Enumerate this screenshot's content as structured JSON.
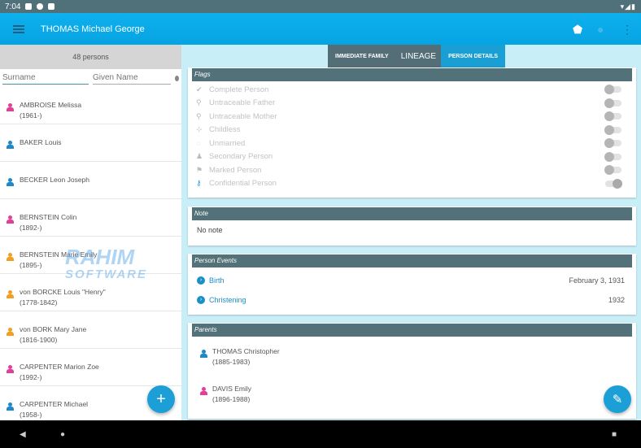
{
  "status": {
    "time": "7:04",
    "right": "▾◢▮"
  },
  "appbar": {
    "title": "THOMAS Michael George"
  },
  "left": {
    "count": "48 persons",
    "surname_placeholder": "Surname",
    "given_placeholder": "Given Name",
    "persons": [
      {
        "name": "AMBROISE Melissa",
        "dates": "(1961-)",
        "sex": "female"
      },
      {
        "name": "BAKER Louis",
        "dates": "",
        "sex": "male"
      },
      {
        "name": "BECKER Leon Joseph",
        "dates": "",
        "sex": "male"
      },
      {
        "name": "BERNSTEIN Colin",
        "dates": "(1892-)",
        "sex": "female"
      },
      {
        "name": "BERNSTEIN Marie Emily",
        "dates": "(1895-)",
        "sex": "unknown"
      },
      {
        "name": "von BORCKE Louis \"Henry\"",
        "dates": "(1778-1842)",
        "sex": "unknown"
      },
      {
        "name": "von BORK Mary Jane",
        "dates": "(1816-1900)",
        "sex": "unknown"
      },
      {
        "name": "CARPENTER Marion Zoe",
        "dates": "(1992-)",
        "sex": "female"
      },
      {
        "name": "CARPENTER Michael",
        "dates": "(1958-)",
        "sex": "male"
      }
    ]
  },
  "tabs": [
    {
      "label": "IMMEDIATE FAMILY"
    },
    {
      "label": "LINEAGE"
    },
    {
      "label": "PERSON DETAILS",
      "active": true
    }
  ],
  "flags": {
    "title": "Flags",
    "items": [
      {
        "label": "Complete Person",
        "icon": "check-circle-icon",
        "on": false
      },
      {
        "label": "Untraceable Father",
        "icon": "untraceable-father-icon",
        "on": false
      },
      {
        "label": "Untraceable Mother",
        "icon": "untraceable-mother-icon",
        "on": false
      },
      {
        "label": "Childless",
        "icon": "childless-icon",
        "on": false
      },
      {
        "label": "Unmarried",
        "icon": "unmarried-icon",
        "on": false
      },
      {
        "label": "Secondary Person",
        "icon": "person-icon",
        "on": false
      },
      {
        "label": "Marked Person",
        "icon": "flag-icon",
        "on": false
      },
      {
        "label": "Confidential Person",
        "icon": "key-icon",
        "on": true
      }
    ]
  },
  "note": {
    "title": "Note",
    "text": "No note"
  },
  "events": {
    "title": "Person Events",
    "items": [
      {
        "label": "Birth",
        "date": "February 3, 1931"
      },
      {
        "label": "Christening",
        "date": "1932"
      }
    ]
  },
  "parents": {
    "title": "Parents",
    "items": [
      {
        "name": "THOMAS Christopher",
        "dates": "(1885-1983)",
        "sex": "male"
      },
      {
        "name": "DAVIS Emily",
        "dates": "(1896-1988)",
        "sex": "female"
      }
    ]
  },
  "watermark": {
    "line1": "RAHIM",
    "line2": "SOFTWARE"
  },
  "colors": {
    "male": "#1e88c8",
    "female": "#e0409a",
    "unknown": "#f0a020",
    "accent": "#1a9fd4"
  }
}
